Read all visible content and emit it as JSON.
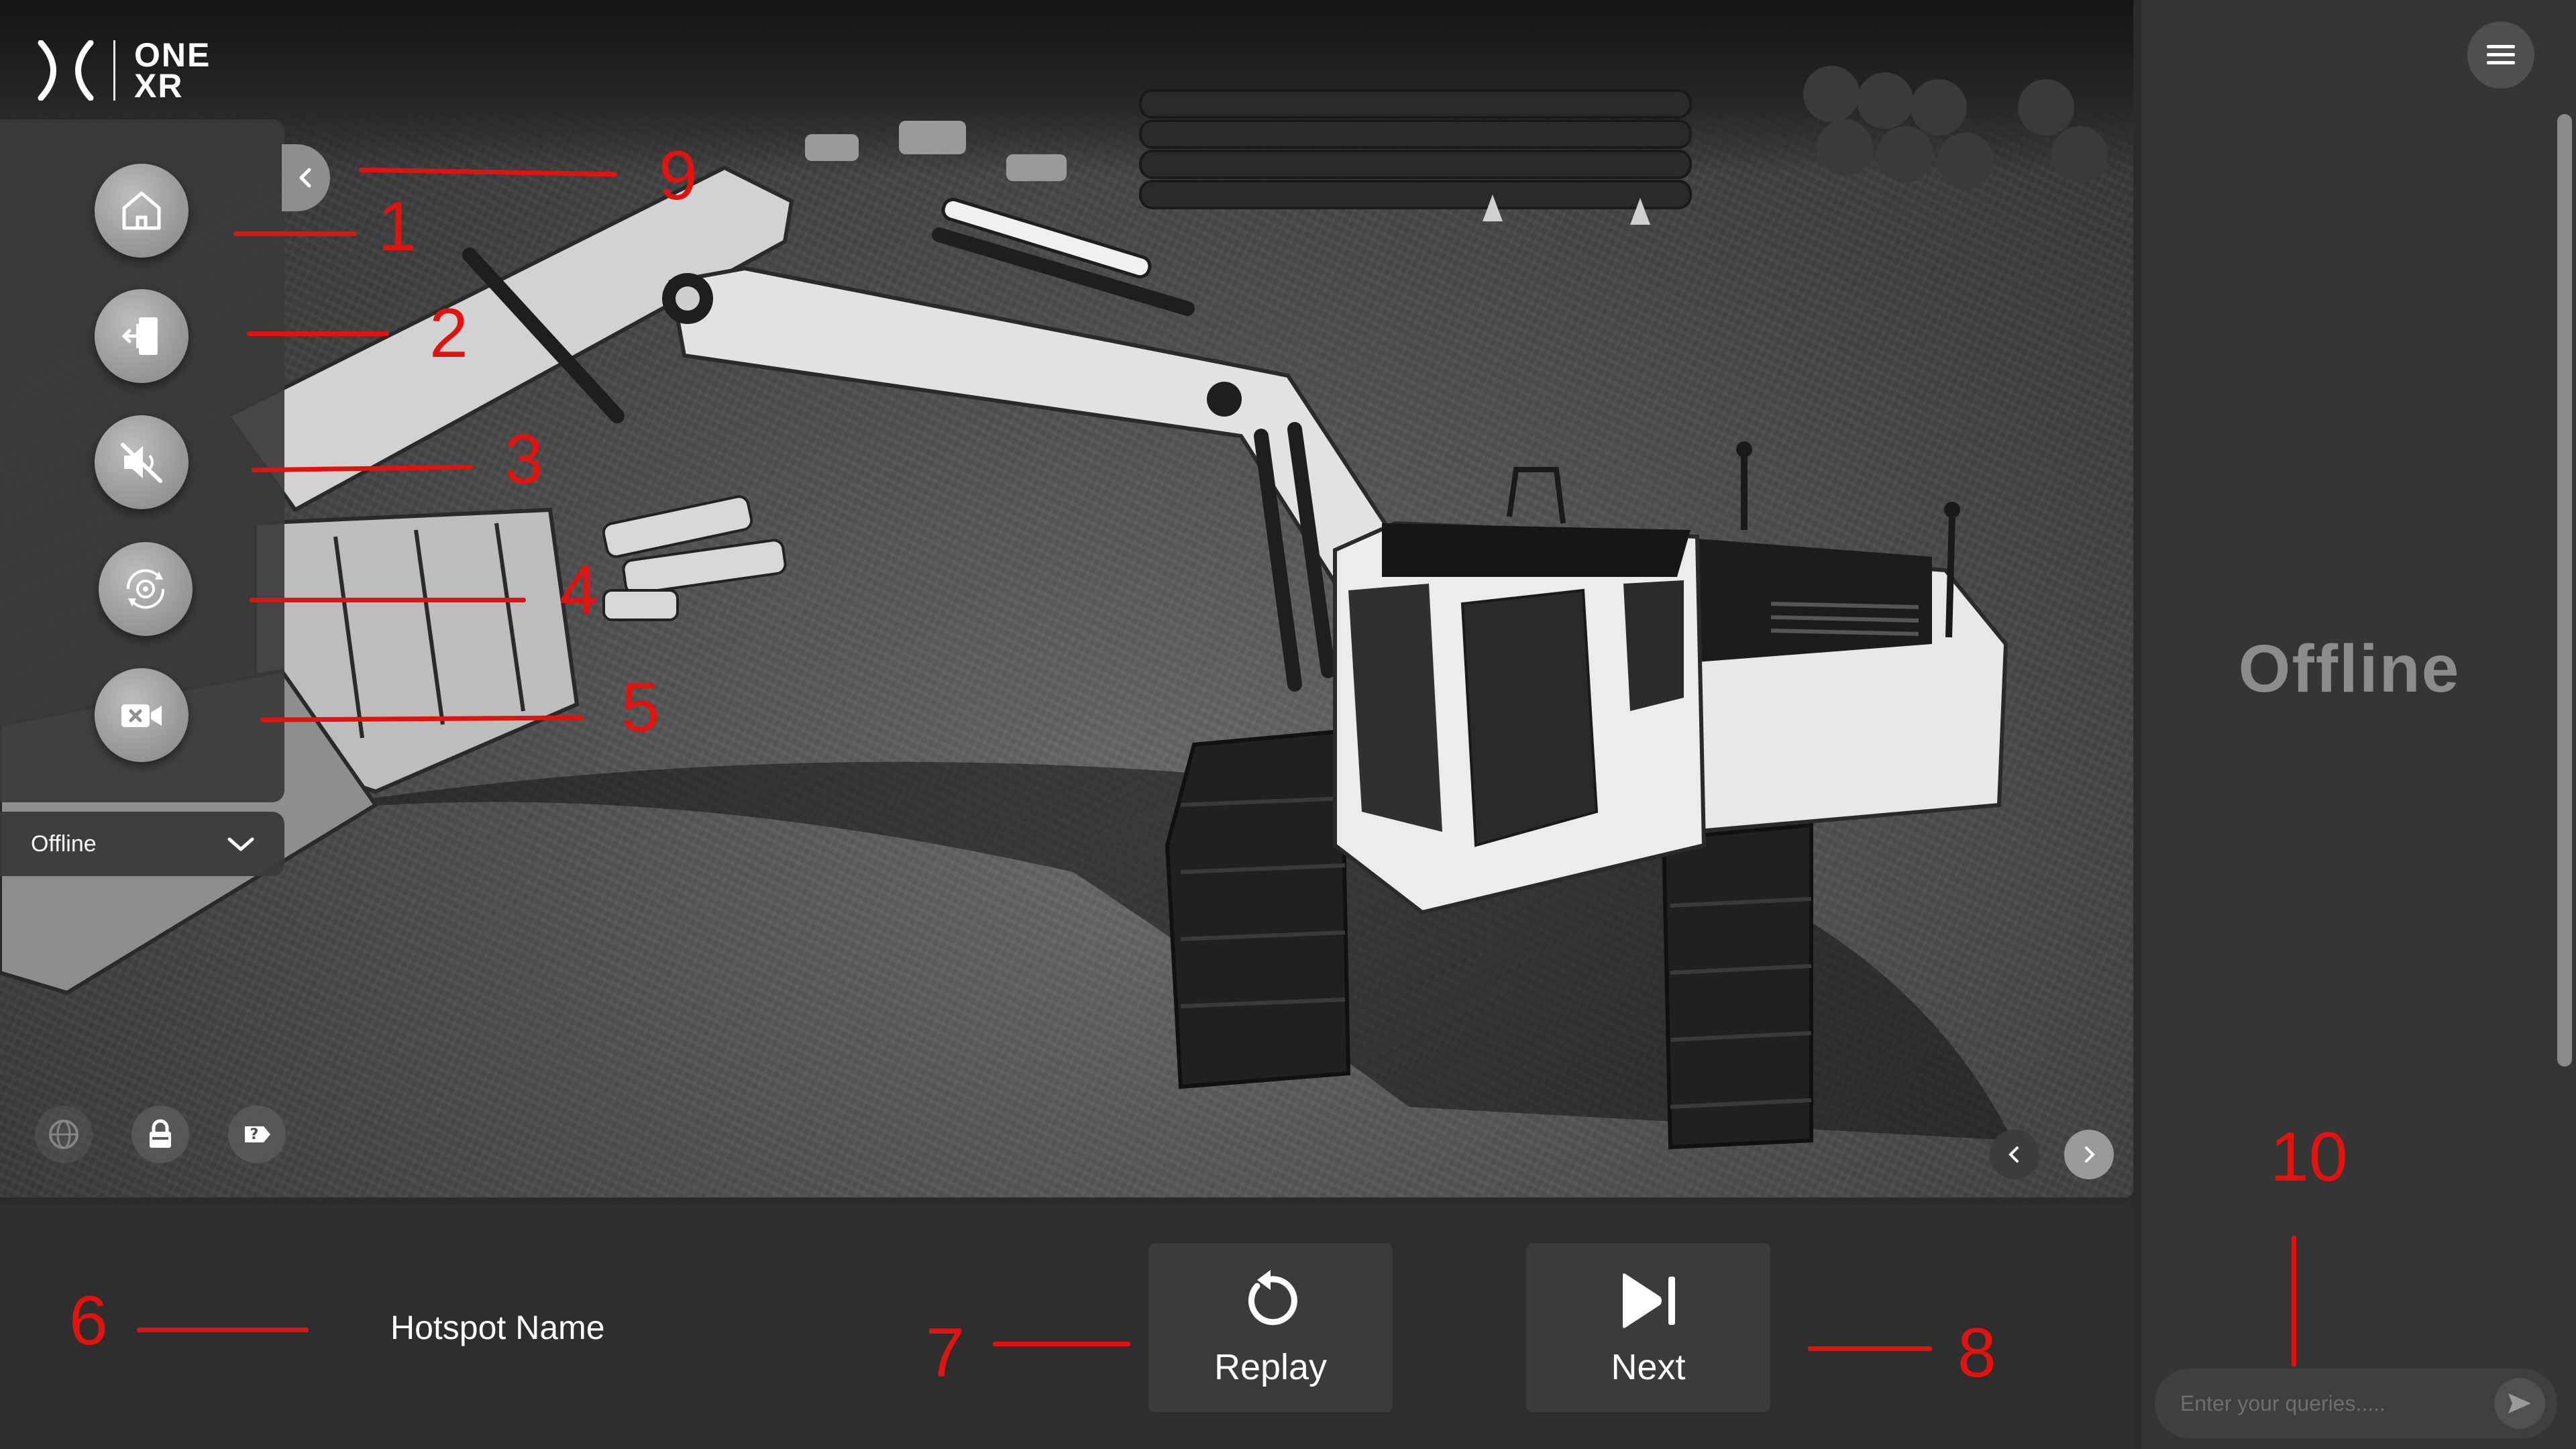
{
  "brand": {
    "line1": "ONE",
    "line2": "XR"
  },
  "toolbar": {
    "buttons": [
      {
        "name": "home-button",
        "icon": "home-icon"
      },
      {
        "name": "exit-button",
        "icon": "exit-door-icon"
      },
      {
        "name": "mute-button",
        "icon": "speaker-muted-icon"
      },
      {
        "name": "reset-view-button",
        "icon": "rotate-target-icon"
      },
      {
        "name": "video-off-button",
        "icon": "video-off-icon"
      }
    ],
    "collapse_icon": "chevron-left-icon"
  },
  "mode_select": {
    "value": "Offline",
    "icon": "chevron-down-icon"
  },
  "bottom_icons": [
    "globe-icon",
    "lock-icon",
    "help-tag-icon"
  ],
  "scene_nav": {
    "prev_icon": "chevron-left-icon",
    "next_icon": "chevron-right-icon"
  },
  "bottom_bar": {
    "hotspot_name": "Hotspot Name",
    "replay_label": "Replay",
    "next_label": "Next"
  },
  "chat": {
    "status": "Offline",
    "input_placeholder": "Enter your queries.....",
    "menu_icon": "hamburger-menu-icon",
    "send_icon": "send-icon"
  },
  "annotations": [
    "1",
    "2",
    "3",
    "4",
    "5",
    "6",
    "7",
    "8",
    "9",
    "10"
  ],
  "colors": {
    "annotation": "#e0130f",
    "panel": "#353535",
    "bar": "#2e2e2e"
  }
}
